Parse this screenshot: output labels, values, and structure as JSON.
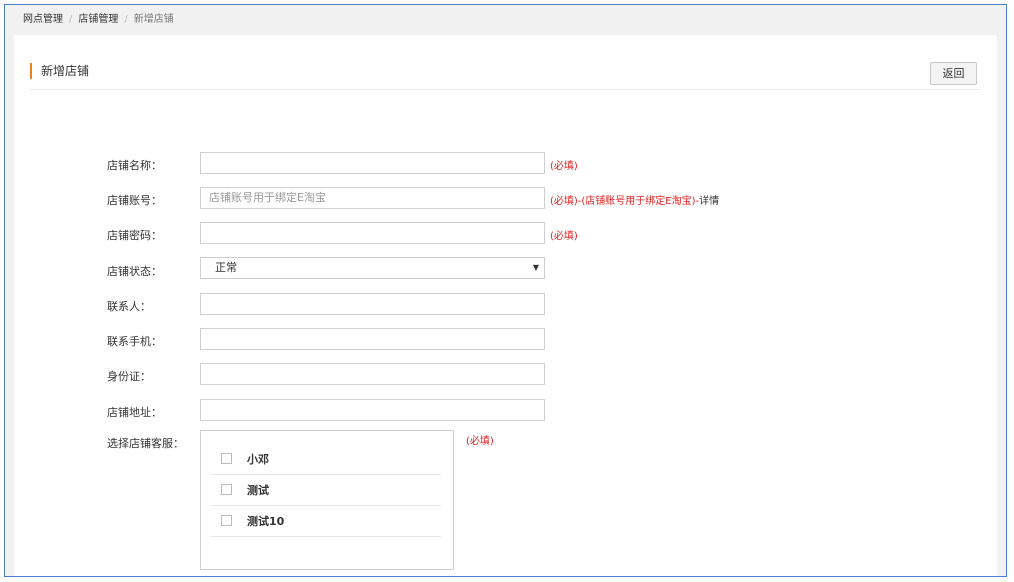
{
  "breadcrumb": {
    "item1": "网点管理",
    "sep": "/",
    "item2": "店铺管理",
    "current": "新增店铺"
  },
  "panel": {
    "title": "新增店铺",
    "back_label": "返回"
  },
  "form": {
    "name_label": "店铺名称：",
    "name_value": "",
    "name_hint": "(必填)",
    "account_label": "店铺账号：",
    "account_placeholder": "店铺账号用于绑定E淘宝",
    "account_hint_required": "(必填)-(店铺账号用于绑定E淘宝)-",
    "account_hint_link": "详情",
    "password_label": "店铺密码：",
    "password_hint": "(必填)",
    "status_label": "店铺状态：",
    "status_value": "正常",
    "contact_label": "联系人：",
    "phone_label": "联系手机：",
    "idcard_label": "身份证：",
    "address_label": "店铺地址：",
    "staff_label": "选择店铺客服：",
    "staff_hint": "(必填)",
    "staff": [
      {
        "name": "小邓",
        "checked": false
      },
      {
        "name": "测试",
        "checked": false
      },
      {
        "name": "测试10",
        "checked": false
      }
    ]
  },
  "colors": {
    "accent": "#f07f1b",
    "required": "#e02020",
    "frame_border": "#4a7fd0"
  }
}
